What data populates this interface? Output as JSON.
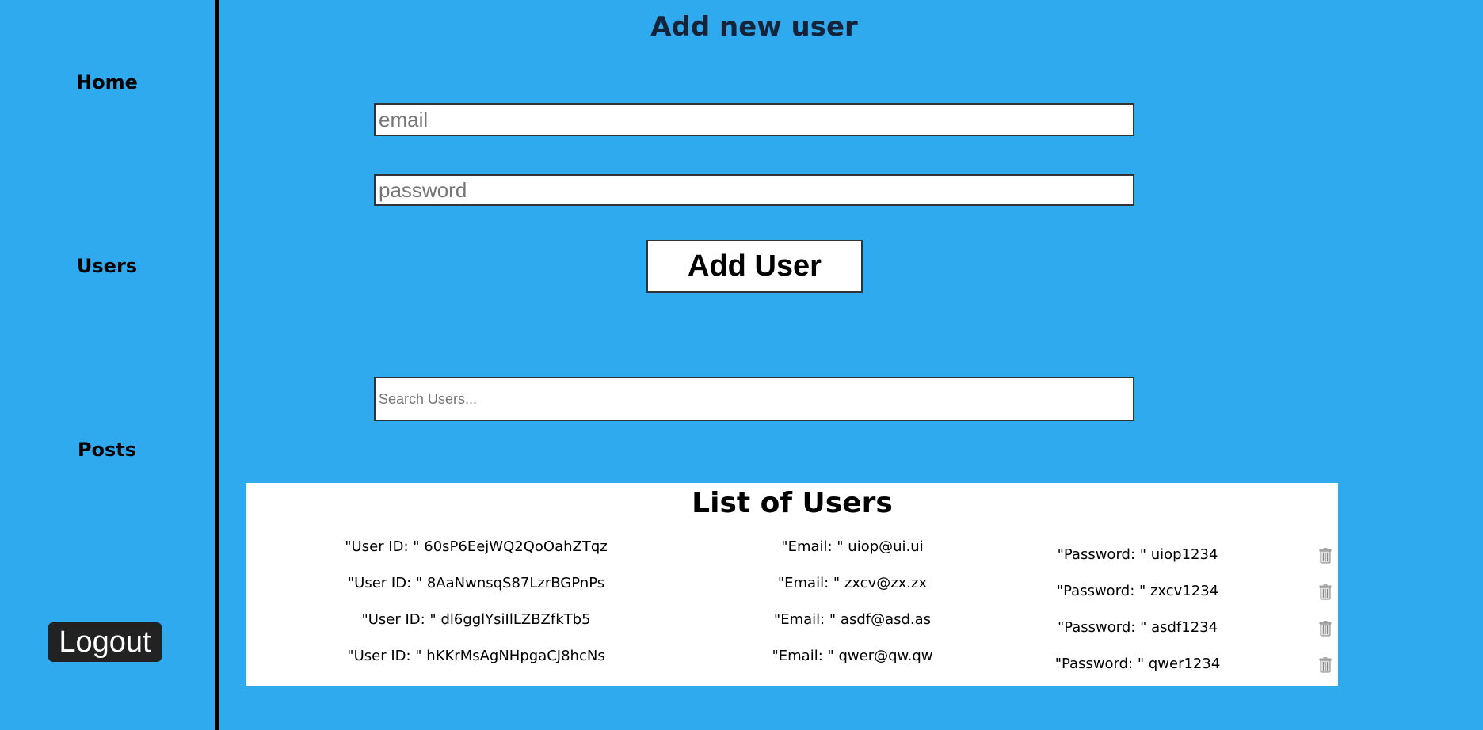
{
  "sidebar": {
    "items": [
      {
        "label": "Home"
      },
      {
        "label": "Users"
      },
      {
        "label": "Posts"
      }
    ],
    "logout_label": "Logout"
  },
  "add_user": {
    "title": "Add new user",
    "email_placeholder": "email",
    "password_placeholder": "password",
    "button_label": "Add User"
  },
  "search": {
    "placeholder": "Search Users..."
  },
  "users_list": {
    "title": "List of Users",
    "rows": [
      {
        "id": "\"User ID: \" 60sP6EejWQ2QoOahZTqz",
        "email": "\"Email: \" uiop@ui.ui",
        "password": "\"Password: \" uiop1234"
      },
      {
        "id": "\"User ID: \" 8AaNwnsqS87LzrBGPnPs",
        "email": "\"Email: \" zxcv@zx.zx",
        "password": "\"Password: \" zxcv1234"
      },
      {
        "id": "\"User ID: \" dl6gglYsiIlLZBZfkTb5",
        "email": "\"Email: \" asdf@asd.as",
        "password": "\"Password: \" asdf1234"
      },
      {
        "id": "\"User ID: \" hKKrMsAgNHpgaCJ8hcNs",
        "email": "\"Email: \" qwer@qw.qw",
        "password": "\"Password: \" qwer1234"
      }
    ]
  },
  "colors": {
    "background": "#30aaee",
    "panel": "#ffffff",
    "logout_bg": "#222222"
  }
}
